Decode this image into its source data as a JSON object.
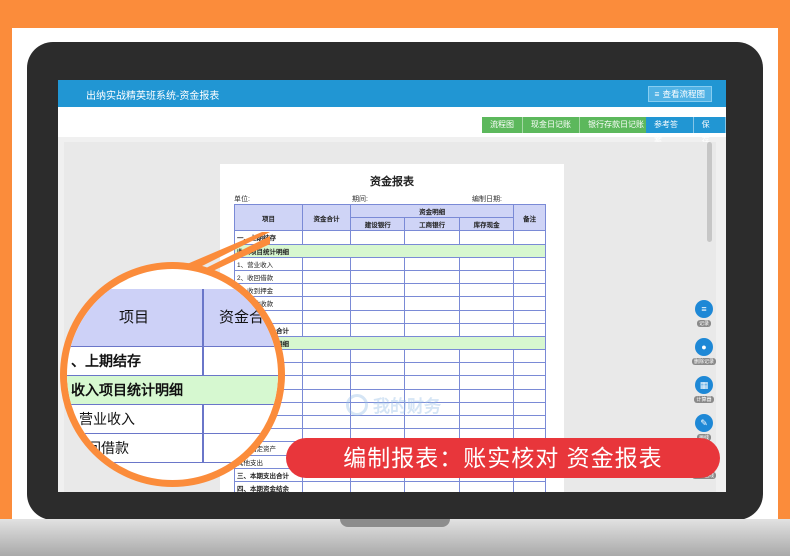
{
  "app": {
    "title": "出纳实战精英班系统-资金报表",
    "flow_button": "查看流程图"
  },
  "toolbar": {
    "green": [
      "流程图",
      "现金日记账",
      "银行存款日记账"
    ],
    "blue": [
      "参考答案",
      "保存"
    ]
  },
  "report": {
    "title": "资金报表",
    "meta": {
      "unit": "单位:",
      "period": "期间:",
      "date": "编制日期:"
    },
    "headers": {
      "item": "项目",
      "total": "资金合计",
      "detail": "资金明细",
      "ccb": "建设银行",
      "icbc": "工商银行",
      "cash": "库存现金",
      "remark": "备注"
    },
    "rows": [
      {
        "label": "一、上期结存",
        "style": "bold"
      },
      {
        "label": "收入项目统计明细",
        "style": "sec"
      },
      {
        "label": "1、营业收入",
        "style": ""
      },
      {
        "label": "2、收回借款",
        "style": ""
      },
      {
        "label": "3、收到押金",
        "style": ""
      },
      {
        "label": "4、其他收款",
        "style": ""
      },
      {
        "label": "",
        "style": ""
      },
      {
        "label": "二、本期收入合计",
        "style": "bold"
      },
      {
        "label": "支出项目统计明细",
        "style": "sec"
      },
      {
        "label": "",
        "style": ""
      },
      {
        "label": "",
        "style": ""
      },
      {
        "label": "",
        "style": ""
      },
      {
        "label": "",
        "style": ""
      },
      {
        "label": "",
        "style": ""
      },
      {
        "label": "",
        "style": ""
      },
      {
        "label": "支付押金",
        "style": ""
      },
      {
        "label": "购置固定资产",
        "style": ""
      },
      {
        "label": "其他支出",
        "style": ""
      },
      {
        "label": "三、本期支出合计",
        "style": "bold"
      },
      {
        "label": "四、本期资金结余",
        "style": "bold"
      }
    ]
  },
  "side_tools": [
    {
      "icon": "≡",
      "label": "记录"
    },
    {
      "icon": "●",
      "label": "删除记录"
    },
    {
      "icon": "▦",
      "label": "计算器"
    },
    {
      "icon": "✎",
      "label": "画线"
    },
    {
      "icon": "●",
      "label": "删除画线"
    }
  ],
  "watermark": "我的财务",
  "zoom": {
    "item": "项目",
    "total": "资金合计",
    "rows": [
      "、上期结存",
      "收入项目统计明细",
      "营业收入",
      "回借款"
    ]
  },
  "banner": "编制报表：账实核对 资金报表",
  "colors": {
    "accent": "#2196d3",
    "orange": "#fb8c3b",
    "banner": "#e8363b",
    "green_btn": "#5cb85c"
  }
}
